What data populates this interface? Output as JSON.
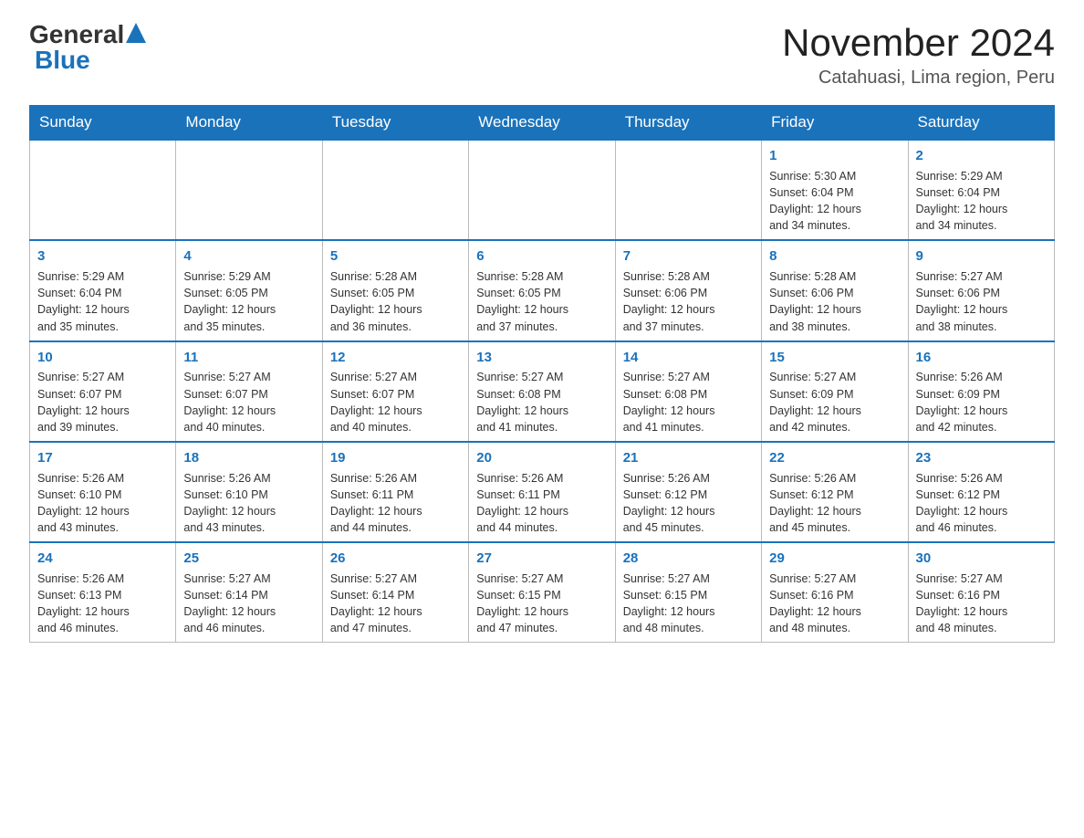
{
  "logo": {
    "general": "General",
    "blue": "Blue"
  },
  "title": "November 2024",
  "subtitle": "Catahuasi, Lima region, Peru",
  "days_of_week": [
    "Sunday",
    "Monday",
    "Tuesday",
    "Wednesday",
    "Thursday",
    "Friday",
    "Saturday"
  ],
  "weeks": [
    [
      {
        "day": "",
        "info": ""
      },
      {
        "day": "",
        "info": ""
      },
      {
        "day": "",
        "info": ""
      },
      {
        "day": "",
        "info": ""
      },
      {
        "day": "",
        "info": ""
      },
      {
        "day": "1",
        "info": "Sunrise: 5:30 AM\nSunset: 6:04 PM\nDaylight: 12 hours\nand 34 minutes."
      },
      {
        "day": "2",
        "info": "Sunrise: 5:29 AM\nSunset: 6:04 PM\nDaylight: 12 hours\nand 34 minutes."
      }
    ],
    [
      {
        "day": "3",
        "info": "Sunrise: 5:29 AM\nSunset: 6:04 PM\nDaylight: 12 hours\nand 35 minutes."
      },
      {
        "day": "4",
        "info": "Sunrise: 5:29 AM\nSunset: 6:05 PM\nDaylight: 12 hours\nand 35 minutes."
      },
      {
        "day": "5",
        "info": "Sunrise: 5:28 AM\nSunset: 6:05 PM\nDaylight: 12 hours\nand 36 minutes."
      },
      {
        "day": "6",
        "info": "Sunrise: 5:28 AM\nSunset: 6:05 PM\nDaylight: 12 hours\nand 37 minutes."
      },
      {
        "day": "7",
        "info": "Sunrise: 5:28 AM\nSunset: 6:06 PM\nDaylight: 12 hours\nand 37 minutes."
      },
      {
        "day": "8",
        "info": "Sunrise: 5:28 AM\nSunset: 6:06 PM\nDaylight: 12 hours\nand 38 minutes."
      },
      {
        "day": "9",
        "info": "Sunrise: 5:27 AM\nSunset: 6:06 PM\nDaylight: 12 hours\nand 38 minutes."
      }
    ],
    [
      {
        "day": "10",
        "info": "Sunrise: 5:27 AM\nSunset: 6:07 PM\nDaylight: 12 hours\nand 39 minutes."
      },
      {
        "day": "11",
        "info": "Sunrise: 5:27 AM\nSunset: 6:07 PM\nDaylight: 12 hours\nand 40 minutes."
      },
      {
        "day": "12",
        "info": "Sunrise: 5:27 AM\nSunset: 6:07 PM\nDaylight: 12 hours\nand 40 minutes."
      },
      {
        "day": "13",
        "info": "Sunrise: 5:27 AM\nSunset: 6:08 PM\nDaylight: 12 hours\nand 41 minutes."
      },
      {
        "day": "14",
        "info": "Sunrise: 5:27 AM\nSunset: 6:08 PM\nDaylight: 12 hours\nand 41 minutes."
      },
      {
        "day": "15",
        "info": "Sunrise: 5:27 AM\nSunset: 6:09 PM\nDaylight: 12 hours\nand 42 minutes."
      },
      {
        "day": "16",
        "info": "Sunrise: 5:26 AM\nSunset: 6:09 PM\nDaylight: 12 hours\nand 42 minutes."
      }
    ],
    [
      {
        "day": "17",
        "info": "Sunrise: 5:26 AM\nSunset: 6:10 PM\nDaylight: 12 hours\nand 43 minutes."
      },
      {
        "day": "18",
        "info": "Sunrise: 5:26 AM\nSunset: 6:10 PM\nDaylight: 12 hours\nand 43 minutes."
      },
      {
        "day": "19",
        "info": "Sunrise: 5:26 AM\nSunset: 6:11 PM\nDaylight: 12 hours\nand 44 minutes."
      },
      {
        "day": "20",
        "info": "Sunrise: 5:26 AM\nSunset: 6:11 PM\nDaylight: 12 hours\nand 44 minutes."
      },
      {
        "day": "21",
        "info": "Sunrise: 5:26 AM\nSunset: 6:12 PM\nDaylight: 12 hours\nand 45 minutes."
      },
      {
        "day": "22",
        "info": "Sunrise: 5:26 AM\nSunset: 6:12 PM\nDaylight: 12 hours\nand 45 minutes."
      },
      {
        "day": "23",
        "info": "Sunrise: 5:26 AM\nSunset: 6:12 PM\nDaylight: 12 hours\nand 46 minutes."
      }
    ],
    [
      {
        "day": "24",
        "info": "Sunrise: 5:26 AM\nSunset: 6:13 PM\nDaylight: 12 hours\nand 46 minutes."
      },
      {
        "day": "25",
        "info": "Sunrise: 5:27 AM\nSunset: 6:14 PM\nDaylight: 12 hours\nand 46 minutes."
      },
      {
        "day": "26",
        "info": "Sunrise: 5:27 AM\nSunset: 6:14 PM\nDaylight: 12 hours\nand 47 minutes."
      },
      {
        "day": "27",
        "info": "Sunrise: 5:27 AM\nSunset: 6:15 PM\nDaylight: 12 hours\nand 47 minutes."
      },
      {
        "day": "28",
        "info": "Sunrise: 5:27 AM\nSunset: 6:15 PM\nDaylight: 12 hours\nand 48 minutes."
      },
      {
        "day": "29",
        "info": "Sunrise: 5:27 AM\nSunset: 6:16 PM\nDaylight: 12 hours\nand 48 minutes."
      },
      {
        "day": "30",
        "info": "Sunrise: 5:27 AM\nSunset: 6:16 PM\nDaylight: 12 hours\nand 48 minutes."
      }
    ]
  ]
}
